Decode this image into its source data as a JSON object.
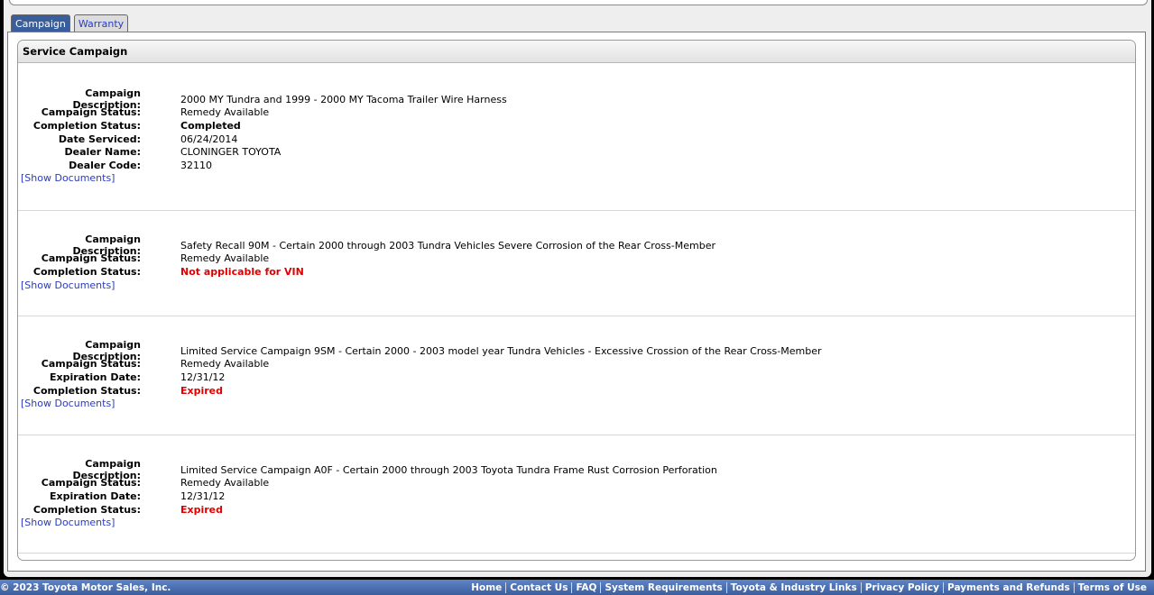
{
  "tabs": [
    {
      "label": "Campaign"
    },
    {
      "label": "Warranty"
    }
  ],
  "panel": {
    "title": "Service Campaign"
  },
  "labels": {
    "description": "Campaign Description:",
    "campaign_status": "Campaign Status:",
    "completion_status": "Completion Status:",
    "date_serviced": "Date Serviced:",
    "dealer_name": "Dealer Name:",
    "dealer_code": "Dealer Code:",
    "expiration_date": "Expiration Date:",
    "show_documents": "[Show Documents]"
  },
  "records": [
    {
      "description": "2000 MY Tundra and 1999 - 2000 MY Tacoma Trailer Wire Harness",
      "campaign_status": "Remedy Available",
      "completion_status": "Completed",
      "date_serviced": "06/24/2014",
      "dealer_name": "CLONINGER TOYOTA",
      "dealer_code": "32110"
    },
    {
      "description": "Safety Recall 90M - Certain 2000 through 2003 Tundra Vehicles Severe Corrosion of the Rear Cross-Member",
      "campaign_status": "Remedy Available",
      "completion_status": "Not applicable for VIN"
    },
    {
      "description": "Limited Service Campaign 9SM - Certain 2000 - 2003 model year Tundra Vehicles - Excessive Crossion of the Rear Cross-Member",
      "campaign_status": "Remedy Available",
      "expiration_date": "12/31/12",
      "completion_status": "Expired"
    },
    {
      "description": "Limited Service Campaign A0F - Certain 2000 through 2003 Toyota Tundra Frame Rust Corrosion Perforation",
      "campaign_status": "Remedy Available",
      "expiration_date": "12/31/12",
      "completion_status": "Expired"
    }
  ],
  "footer": {
    "copyright": "© 2023 Toyota Motor Sales, Inc.",
    "links": [
      "Home",
      "Contact Us",
      "FAQ",
      "System Requirements",
      "Toyota & Industry Links",
      "Privacy Policy",
      "Payments and Refunds",
      "Terms of Use"
    ]
  },
  "colors": {
    "accent": "#3a5e9c",
    "link": "#2a3bbf",
    "alert": "#e00000"
  }
}
